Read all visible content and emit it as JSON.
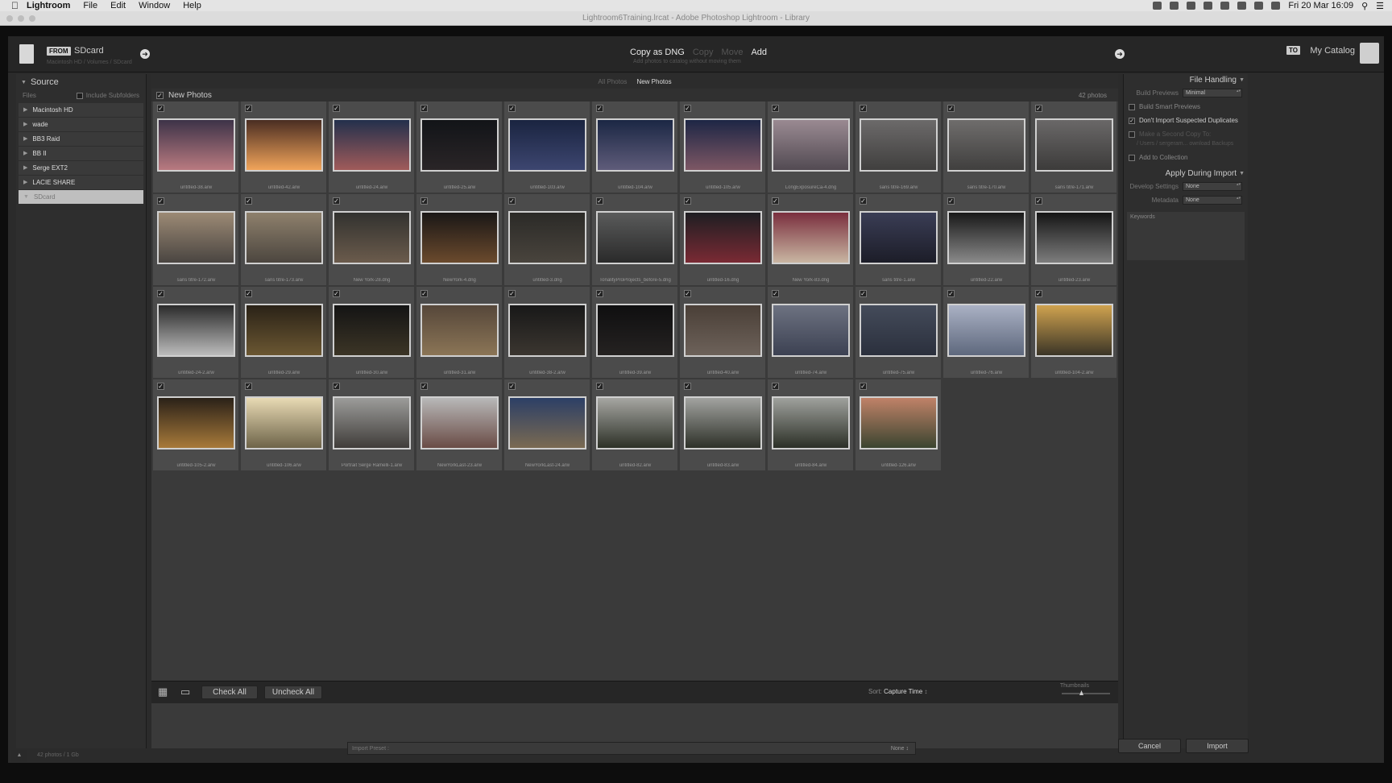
{
  "menubar": {
    "app": "Lightroom",
    "items": [
      "File",
      "Edit",
      "Window",
      "Help"
    ],
    "clock": "Fri 20 Mar  16:09"
  },
  "window": {
    "title": "Lightroom6Training.lrcat - Adobe Photoshop Lightroom - Library"
  },
  "import": {
    "from_badge": "FROM",
    "source": "SDcard",
    "source_sub": "Macintosh HD / Volumes / SDcard",
    "modes": [
      "Copy as DNG",
      "Copy",
      "Move",
      "Add"
    ],
    "modes_sub": "Add photos to catalog without moving them",
    "to_badge": "TO",
    "destination": "My Catalog"
  },
  "source_panel": {
    "title": "Source",
    "files_label": "Files",
    "include_subfolders": "Include Subfolders",
    "volumes": [
      "Macintosh HD",
      "wade",
      "BB3 Raid",
      "BB II",
      "Serge EXT2",
      "LACIE SHARE",
      "SDcard"
    ],
    "selected_volume": "SDcard"
  },
  "view_tabs": [
    "All Photos",
    "New Photos"
  ],
  "grid": {
    "header": "New Photos",
    "count": "42 photos"
  },
  "photos": [
    {
      "name": "untitled-38.arw",
      "c1": "#3d3348",
      "c2": "#b97a80"
    },
    {
      "name": "untitled-42.arw",
      "c1": "#4a2d22",
      "c2": "#f1a45a"
    },
    {
      "name": "untitled-24.arw",
      "c1": "#23304c",
      "c2": "#a05b5a"
    },
    {
      "name": "untitled-25.arw",
      "c1": "#121418",
      "c2": "#2a2527"
    },
    {
      "name": "untitled-103.arw",
      "c1": "#1a2440",
      "c2": "#3d4670"
    },
    {
      "name": "untitled-104.arw",
      "c1": "#1b2744",
      "c2": "#5f5c7a"
    },
    {
      "name": "untitled-105.arw",
      "c1": "#1d2645",
      "c2": "#7d5764"
    },
    {
      "name": "LongExposureCa-4.dng",
      "c1": "#9a8a92",
      "c2": "#524a52"
    },
    {
      "name": "sans titre-169.arw",
      "c1": "#6c6a6a",
      "c2": "#403f3e"
    },
    {
      "name": "sans titre-170.arw",
      "c1": "#6f6d6c",
      "c2": "#403f3e"
    },
    {
      "name": "sans titre-171.arw",
      "c1": "#6a6868",
      "c2": "#3c3b3a"
    },
    {
      "name": "sans titre-172.arw",
      "c1": "#9c8a75",
      "c2": "#4a4541"
    },
    {
      "name": "sans titre-173.arw",
      "c1": "#8e806c",
      "c2": "#4c463f"
    },
    {
      "name": "New York-28.dng",
      "c1": "#32322f",
      "c2": "#6b5b4c"
    },
    {
      "name": "NewYork-4.dng",
      "c1": "#1a1716",
      "c2": "#6b4a2d"
    },
    {
      "name": "untitled-3.dng",
      "c1": "#2b2a27",
      "c2": "#49443d"
    },
    {
      "name": "TonalityProProjects_before-5.dng",
      "c1": "#5a5b5b",
      "c2": "#2a2a2a"
    },
    {
      "name": "untitled-16.dng",
      "c1": "#1e1e22",
      "c2": "#7a2a34"
    },
    {
      "name": "New York-83.dng",
      "c1": "#7a2f3e",
      "c2": "#c9b6a2"
    },
    {
      "name": "sans titre-1.arw",
      "c1": "#3a3d55",
      "c2": "#1c1d28"
    },
    {
      "name": "untitled-22.arw",
      "c1": "#181818",
      "c2": "#8a8a8a"
    },
    {
      "name": "untitled-23.arw",
      "c1": "#151515",
      "c2": "#7d7d7d"
    },
    {
      "name": "untitled-24-2.arw",
      "c1": "#2a2a2a",
      "c2": "#bcbcbc"
    },
    {
      "name": "untitled-29.arw",
      "c1": "#2a2217",
      "c2": "#6b5732"
    },
    {
      "name": "untitled-30.arw",
      "c1": "#141414",
      "c2": "#3c3526"
    },
    {
      "name": "untitled-31.arw",
      "c1": "#56473a",
      "c2": "#8b7556"
    },
    {
      "name": "untitled-38-2.arw",
      "c1": "#181818",
      "c2": "#3b3630"
    },
    {
      "name": "untitled-39.arw",
      "c1": "#0f0f10",
      "c2": "#252221"
    },
    {
      "name": "untitled-40.arw",
      "c1": "#4a3f37",
      "c2": "#6d625a"
    },
    {
      "name": "untitled-74.arw",
      "c1": "#6d7281",
      "c2": "#3c4152"
    },
    {
      "name": "untitled-75.arw",
      "c1": "#444b5a",
      "c2": "#2b303d"
    },
    {
      "name": "untitled-76.arw",
      "c1": "#aab1c4",
      "c2": "#5e687d"
    },
    {
      "name": "untitled-104-2.arw",
      "c1": "#d0a34f",
      "c2": "#3b3527"
    },
    {
      "name": "untitled-105-2.arw",
      "c1": "#2a2118",
      "c2": "#a87a3a"
    },
    {
      "name": "untitled-106.arw",
      "c1": "#e8dab4",
      "c2": "#6e6449"
    },
    {
      "name": "Portrait Serge Ramelli-1.arw",
      "c1": "#9c9c9a",
      "c2": "#403d3a"
    },
    {
      "name": "NewYorkLast-23.arw",
      "c1": "#b8b8b8",
      "c2": "#6a4c46"
    },
    {
      "name": "NewYorkLast-24.arw",
      "c1": "#2c3f66",
      "c2": "#7a6a52"
    },
    {
      "name": "untitled-82.arw",
      "c1": "#a6a6a2",
      "c2": "#2d3127"
    },
    {
      "name": "untitled-83.arw",
      "c1": "#a2a3a0",
      "c2": "#2e3129"
    },
    {
      "name": "untitled-84.arw",
      "c1": "#9fa19d",
      "c2": "#2c3027"
    },
    {
      "name": "untitled-126.arw",
      "c1": "#c08268",
      "c2": "#3b4530"
    }
  ],
  "toolbar": {
    "check_all": "Check All",
    "uncheck_all": "Uncheck All",
    "sort_label": "Sort:",
    "sort_value": "Capture Time",
    "thumbnails": "Thumbnails"
  },
  "right_panel": {
    "file_handling": "File Handling",
    "build_previews_label": "Build Previews",
    "build_previews_value": "Minimal",
    "smart_previews": "Build Smart Previews",
    "no_duplicates": "Don't Import Suspected Duplicates",
    "second_copy": "Make a Second Copy To:",
    "second_copy_path": "/ Users / sergeram... ownload Backups",
    "add_to_collection": "Add to Collection",
    "apply_during_import": "Apply During Import",
    "develop_label": "Develop Settings",
    "develop_value": "None",
    "metadata_label": "Metadata",
    "metadata_value": "None",
    "keywords": "Keywords"
  },
  "footer": {
    "status": "42 photos / 1 Gb",
    "preset_label": "Import Preset :",
    "preset_value": "None",
    "cancel": "Cancel",
    "import": "Import"
  }
}
